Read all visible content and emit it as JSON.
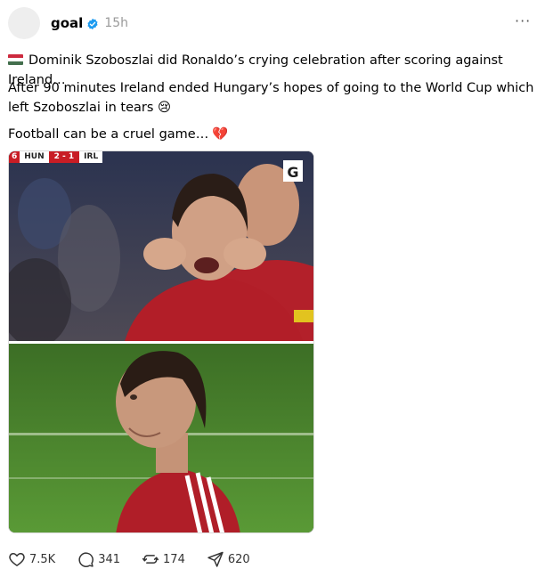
{
  "post": {
    "username": "goal",
    "timestamp": "15h",
    "more_label": "···",
    "line1": "Dominik Szoboszlai did Ronaldo’s crying celebration after scoring against Ireland…",
    "line2": "After 90 minutes Ireland ended Hungary’s hopes of going to the World Cup which left Szoboszlai in tears 😢",
    "line3": "Football can be a cruel game…",
    "line3_emoji": "💔",
    "flag_icon": "hungary-flag-icon"
  },
  "media": {
    "scorebug": {
      "minute_prefix": "6",
      "home": "HUN",
      "score": "2 - 1",
      "away": "IRL"
    },
    "watermark": "G"
  },
  "actions": {
    "likes": "7.5K",
    "comments": "341",
    "reposts": "174",
    "shares": "620"
  },
  "colors": {
    "verified": "#1d9bf0",
    "scorebug_red": "#c81d25",
    "flag_red": "#cd2a3e",
    "flag_green": "#436f4d"
  }
}
